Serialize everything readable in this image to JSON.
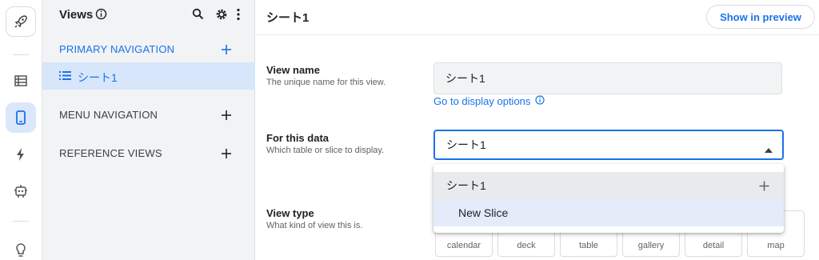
{
  "rail": {
    "items": [
      {
        "icon": "rocket-icon",
        "active": false
      },
      {
        "icon": "table-icon",
        "active": false
      },
      {
        "icon": "phone-icon",
        "active": true
      },
      {
        "icon": "bolt-icon",
        "active": false
      },
      {
        "icon": "bot-icon",
        "active": false
      },
      {
        "icon": "lightbulb-icon",
        "active": false
      }
    ]
  },
  "views_panel": {
    "title": "Views",
    "sections": {
      "primary": "PRIMARY NAVIGATION",
      "menu": "MENU NAVIGATION",
      "reference": "REFERENCE VIEWS"
    },
    "active_item": "シート1"
  },
  "main": {
    "title": "シート1",
    "preview_button": "Show in preview",
    "view_name": {
      "label": "View name",
      "help": "The unique name for this view.",
      "value": "シート1",
      "link": "Go to display options"
    },
    "for_this_data": {
      "label": "For this data",
      "help": "Which table or slice to display.",
      "value": "シート1",
      "options": [
        "シート1",
        "New Slice"
      ]
    },
    "view_type": {
      "label": "View type",
      "help": "What kind of view this is.",
      "options": [
        "calendar",
        "deck",
        "table",
        "gallery",
        "detail",
        "map"
      ]
    }
  },
  "colors": {
    "accent": "#1a73e8",
    "active_bg": "#d7e6fb",
    "panel_bg": "#f1f3f4"
  }
}
